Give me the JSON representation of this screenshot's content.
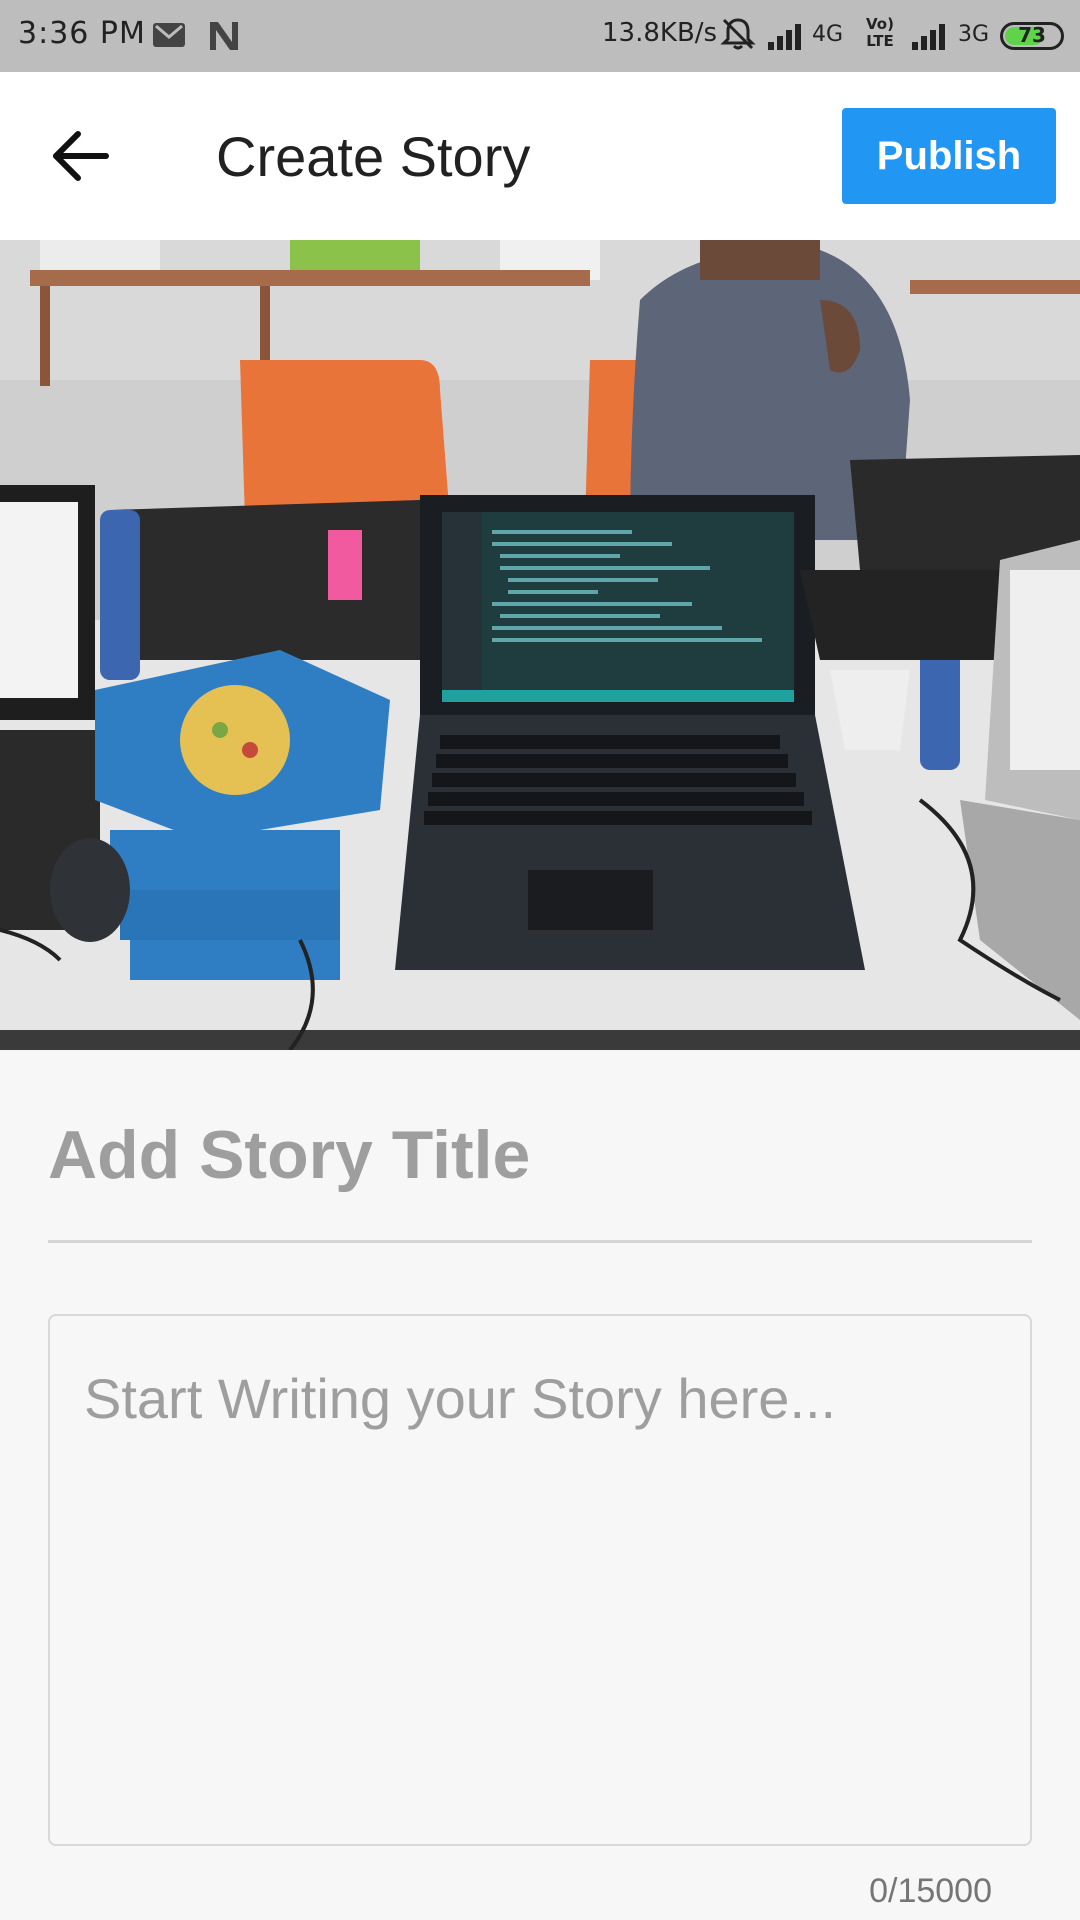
{
  "status_bar": {
    "time": "3:36 PM",
    "network_speed": "13.8KB/s",
    "sim1_network": "4G",
    "volte_line1": "Vo)",
    "volte_line2": "LTE",
    "sim2_network": "3G",
    "battery_level": "73",
    "icons": [
      "gmail-icon",
      "n-notification-icon",
      "mute-icon",
      "signal-icon",
      "battery-icon"
    ]
  },
  "app_bar": {
    "title": "Create Story",
    "publish_label": "Publish",
    "back_icon": "arrow-back-icon",
    "accent_color": "#2196f3"
  },
  "cover_image": {
    "alt": ""
  },
  "form": {
    "title_placeholder": "Add Story Title",
    "title_value": "",
    "story_placeholder": "Start Writing your Story here...",
    "story_value": "",
    "char_counter": "0/15000"
  }
}
